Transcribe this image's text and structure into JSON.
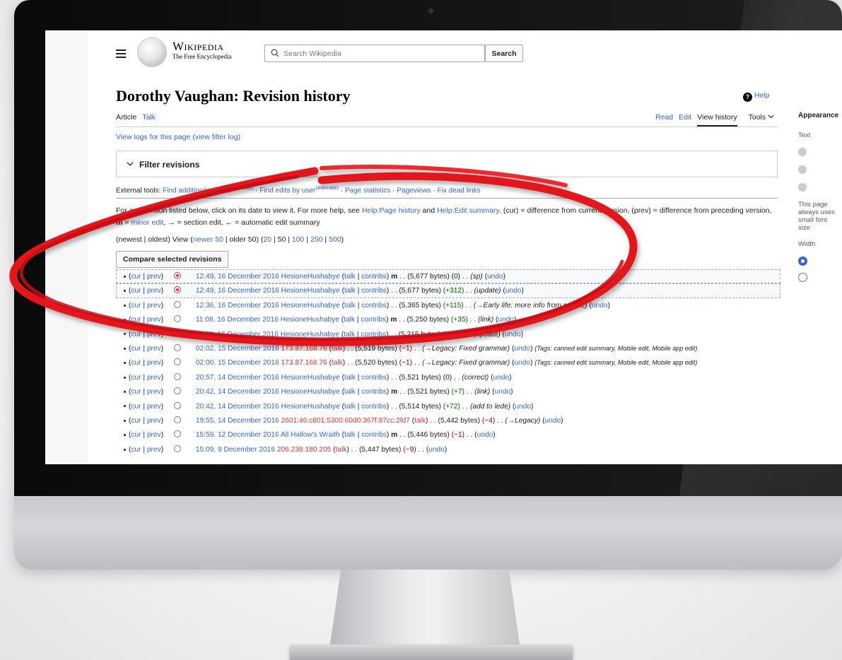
{
  "header": {
    "wordmark_title": "Wikipedia",
    "wordmark_subtitle": "The Free Encyclopedia",
    "search_placeholder": "Search Wikipedia",
    "search_button": "Search"
  },
  "page": {
    "title": "Dorothy Vaughan: Revision history",
    "help": "Help",
    "tabs_left": [
      "Article",
      "Talk"
    ],
    "tabs_right": [
      "Read",
      "Edit",
      "View history",
      "Tools"
    ],
    "logs_link": "View logs for this page",
    "filter_log": "(view filter log)",
    "filter_label": "Filter revisions",
    "external_tools_label": "External tools:",
    "external_tools": [
      {
        "text": "Find addition/removal",
        "sup": "(Alternate)"
      },
      {
        "text": "Find edits by user",
        "sup": "(Alternate)"
      },
      {
        "text": "Page statistics",
        "sup": ""
      },
      {
        "text": "Pageviews",
        "sup": ""
      },
      {
        "text": "Fix dead links",
        "sup": ""
      }
    ],
    "help_text_1": "For any version listed below, click on its date to view it. For more help, see",
    "help_link_1": "Help:Page history",
    "help_and": "and",
    "help_link_2": "Help:Edit summary",
    "help_text_2": ". (cur) = difference from current version, (prev) = difference from preceding",
    "help_text_3": "version,",
    "help_minor_m": "m",
    "help_minor_eq": " = ",
    "help_minor_link": "minor edit",
    "help_section": ", → = section edit, ← = automatic edit summary",
    "view_prefix": "(newest | oldest) View (",
    "view_newer": "newer 50",
    "view_mid": " | older 50) (",
    "view_limits": [
      "20",
      "50",
      "100",
      "250",
      "500"
    ],
    "view_suffix": ")",
    "compare_button": "Compare selected revisions"
  },
  "revisions": [
    {
      "cur": "cur",
      "prev": "prev",
      "date": "12:49, 16 December 2016",
      "user": "HesioneHushabye",
      "talk": "talk",
      "contribs": "contribs",
      "minor": "m",
      "size": "(5,677 bytes)",
      "delta": "(0)",
      "delta_sign": "zero",
      "summary": "(sp)",
      "undo": "undo",
      "tags": "",
      "left_radio": "",
      "right_radio": "on",
      "sel": true,
      "user_red": false
    },
    {
      "cur": "cur",
      "prev": "prev",
      "date": "12:49, 16 December 2016",
      "user": "HesioneHushabye",
      "talk": "talk",
      "contribs": "contribs",
      "minor": "",
      "size": "(5,677 bytes)",
      "delta": "(+312)",
      "delta_sign": "pos",
      "summary": "(update)",
      "undo": "undo",
      "tags": "",
      "left_radio": "on",
      "right_radio": "",
      "sel": true,
      "user_red": false
    },
    {
      "cur": "cur",
      "prev": "prev",
      "date": "12:36, 16 December 2016",
      "user": "HesioneHushabye",
      "talk": "talk",
      "contribs": "contribs",
      "minor": "",
      "size": "(5,365 bytes)",
      "delta": "(+115)",
      "delta_sign": "pos",
      "summary": "(→Early life: more info from source)",
      "undo": "undo",
      "tags": "",
      "left_radio": "off",
      "right_radio": "",
      "sel": false,
      "user_red": false
    },
    {
      "cur": "cur",
      "prev": "prev",
      "date": "11:08, 16 December 2016",
      "user": "HesioneHushabye",
      "talk": "talk",
      "contribs": "contribs",
      "minor": "m",
      "size": "(5,250 bytes)",
      "delta": "(+35)",
      "delta_sign": "pos",
      "summary": "(link)",
      "undo": "undo",
      "tags": "",
      "left_radio": "off",
      "right_radio": "",
      "sel": false,
      "user_red": false
    },
    {
      "cur": "cur",
      "prev": "prev",
      "date": "11:08, 16 December 2016",
      "user": "HesioneHushabye",
      "talk": "talk",
      "contribs": "contribs",
      "minor": "",
      "size": "(5,215 bytes)",
      "delta": "(−283)",
      "delta_sign": "neg",
      "summary": "(update)",
      "undo": "undo",
      "tags": "",
      "left_radio": "off",
      "right_radio": "",
      "sel": false,
      "user_red": false
    },
    {
      "cur": "cur",
      "prev": "prev",
      "date": "02:02, 15 December 2016",
      "user": "173.87.168.76",
      "talk": "talk",
      "contribs": "",
      "minor": "",
      "size": "(5,519 bytes)",
      "delta": "(−1)",
      "delta_sign": "neg",
      "summary": "(→Legacy: Fixed grammar)",
      "undo": "undo",
      "tags": "(Tags: canned edit summary, Mobile edit, Mobile app edit)",
      "left_radio": "off",
      "right_radio": "",
      "sel": false,
      "user_red": true
    },
    {
      "cur": "cur",
      "prev": "prev",
      "date": "02:00, 15 December 2016",
      "user": "173.87.168.76",
      "talk": "talk",
      "contribs": "",
      "minor": "",
      "size": "(5,520 bytes)",
      "delta": "(−1)",
      "delta_sign": "neg",
      "summary": "(→Legacy: Fixed grammar)",
      "undo": "undo",
      "tags": "(Tags: canned edit summary, Mobile edit, Mobile app edit)",
      "left_radio": "off",
      "right_radio": "",
      "sel": false,
      "user_red": true
    },
    {
      "cur": "cur",
      "prev": "prev",
      "date": "20:57, 14 December 2016",
      "user": "HesioneHushabye",
      "talk": "talk",
      "contribs": "contribs",
      "minor": "",
      "size": "(5,521 bytes)",
      "delta": "(0)",
      "delta_sign": "zero",
      "summary": "(correct)",
      "undo": "undo",
      "tags": "",
      "left_radio": "off",
      "right_radio": "",
      "sel": false,
      "user_red": false
    },
    {
      "cur": "cur",
      "prev": "prev",
      "date": "20:42, 14 December 2016",
      "user": "HesioneHushabye",
      "talk": "talk",
      "contribs": "contribs",
      "minor": "m",
      "size": "(5,521 bytes)",
      "delta": "(+7)",
      "delta_sign": "pos",
      "summary": "(link)",
      "undo": "undo",
      "tags": "",
      "left_radio": "off",
      "right_radio": "",
      "sel": false,
      "user_red": false
    },
    {
      "cur": "cur",
      "prev": "prev",
      "date": "20:42, 14 December 2016",
      "user": "HesioneHushabye",
      "talk": "talk",
      "contribs": "contribs",
      "minor": "",
      "size": "(5,514 bytes)",
      "delta": "(+72)",
      "delta_sign": "pos",
      "summary": "(add to lede)",
      "undo": "undo",
      "tags": "",
      "left_radio": "off",
      "right_radio": "",
      "sel": false,
      "user_red": false
    },
    {
      "cur": "cur",
      "prev": "prev",
      "date": "19:55, 14 December 2016",
      "user": "2601:46:c801:5300:60d0:367f:87cc:2fd7",
      "talk": "talk",
      "contribs": "",
      "minor": "",
      "size": "(5,442 bytes)",
      "delta": "(−4)",
      "delta_sign": "neg",
      "summary": "(→Legacy)",
      "undo": "undo",
      "tags": "",
      "left_radio": "off",
      "right_radio": "",
      "sel": false,
      "user_red": true
    },
    {
      "cur": "cur",
      "prev": "prev",
      "date": "15:59, 12 December 2016",
      "user": "All Hallow's Wraith",
      "talk": "talk",
      "contribs": "contribs",
      "minor": "m",
      "size": "(5,446 bytes)",
      "delta": "(−1)",
      "delta_sign": "neg",
      "summary": "",
      "undo": "undo",
      "tags": "",
      "left_radio": "off",
      "right_radio": "",
      "sel": false,
      "user_red": false
    },
    {
      "cur": "cur",
      "prev": "prev",
      "date": "15:09, 9 December 2016",
      "user": "206.238.180.205",
      "talk": "talk",
      "contribs": "",
      "minor": "",
      "size": "(5,447 bytes)",
      "delta": "(−9)",
      "delta_sign": "neg",
      "summary": "",
      "undo": "undo",
      "tags": "",
      "left_radio": "off",
      "right_radio": "",
      "sel": false,
      "user_red": true
    }
  ],
  "sidebar": {
    "heading": "Appearance",
    "text_label": "Text",
    "size_note": "This page always uses small font size",
    "width_label": "Width"
  },
  "colors": {
    "link": "#3366cc",
    "red_link": "#dd3333",
    "positive": "#006400",
    "negative": "#8b0000",
    "annotation": "#e3161b"
  }
}
